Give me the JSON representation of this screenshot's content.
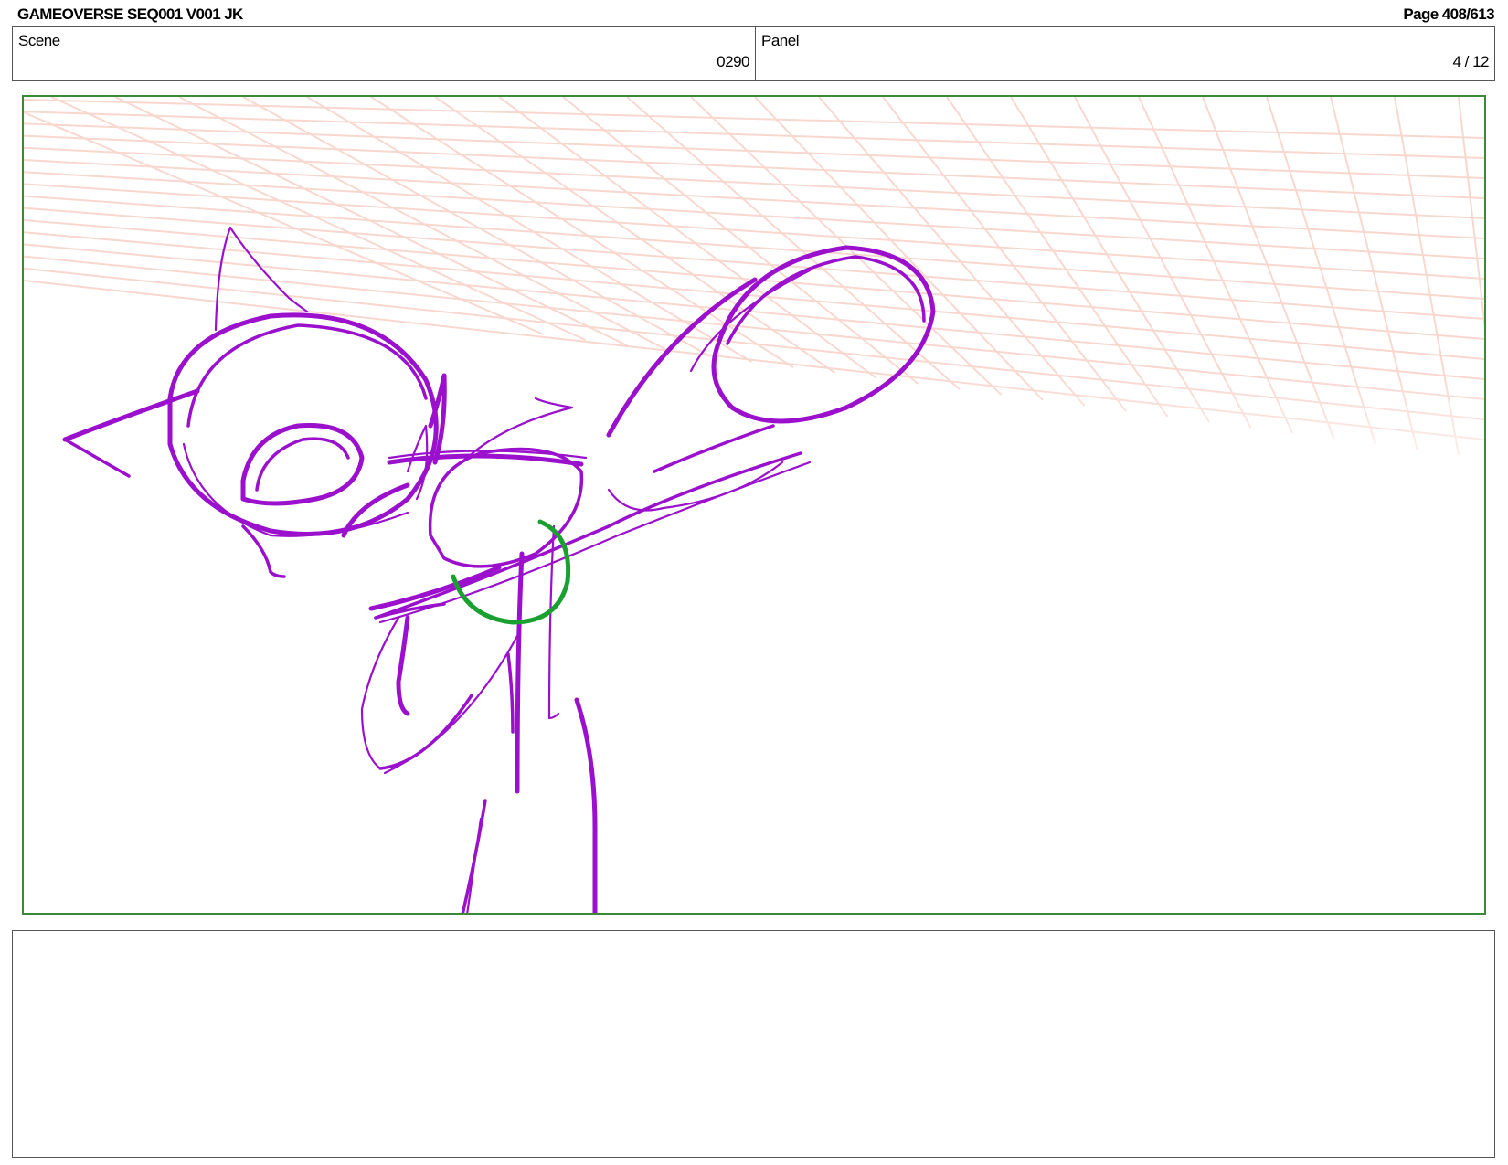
{
  "header": {
    "title": "GAMEOVERSE SEQ001 V001 JK",
    "page": "Page 408/613"
  },
  "info": {
    "scene_label": "Scene",
    "scene_value": "0290",
    "panel_label": "Panel",
    "panel_value": "4 / 12"
  },
  "panel": {
    "sketch_color": "#9a10cc",
    "ring_color": "#1aa030",
    "grid_color": "#f4b8a8",
    "frame_color": "#3a8a3a"
  },
  "notes": {
    "text": ""
  }
}
